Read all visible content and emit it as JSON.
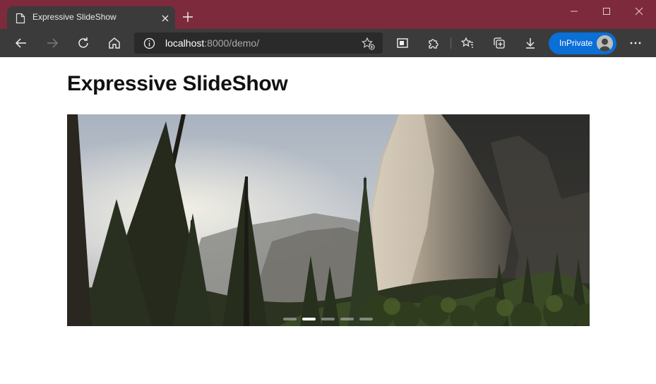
{
  "browser": {
    "tab": {
      "title": "Expressive SlideShow",
      "favicon": "page-icon",
      "close": "close-icon"
    },
    "new_tab": "plus-icon",
    "window_controls": [
      "minimize-icon",
      "maximize-icon",
      "close-icon"
    ],
    "nav": [
      "back-icon",
      "forward-icon",
      "refresh-icon",
      "home-icon"
    ],
    "address": {
      "host": "localhost",
      "path": ":8000/demo/"
    },
    "toolbar_icons": [
      "reader-view-icon",
      "extensions-icon",
      "favorites-icon",
      "collections-icon",
      "downloads-icon"
    ],
    "profile": {
      "label": "InPrivate"
    },
    "menu": "more-icon"
  },
  "page": {
    "title": "Expressive SlideShow"
  },
  "slideshow": {
    "slide_count": 5,
    "active_index": 1
  },
  "colors": {
    "titlebar": "#7d2a3d",
    "toolbar": "#3b3b3b",
    "inprivate": "#0a6fd6"
  }
}
